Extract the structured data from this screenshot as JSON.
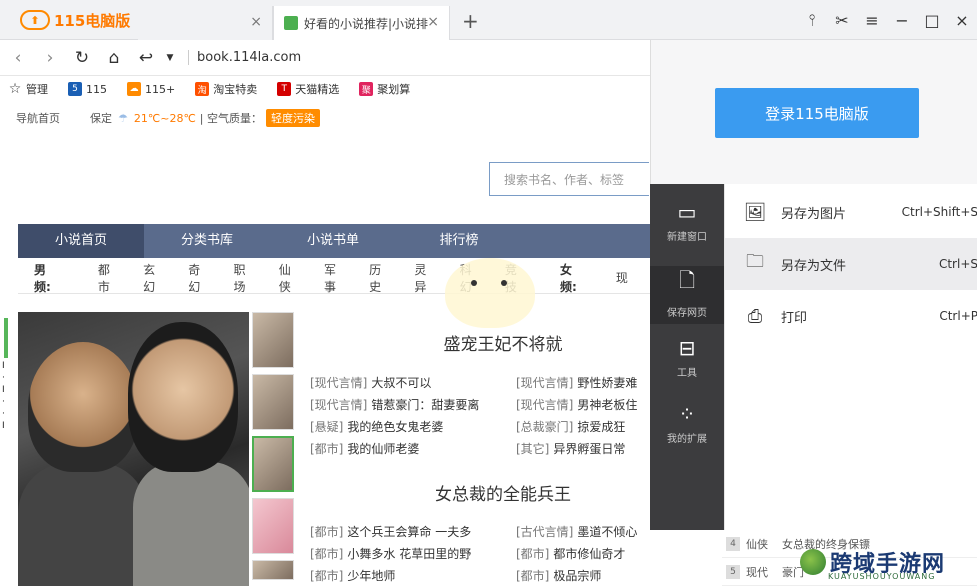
{
  "browser": {
    "logo_text": "115电脑版",
    "tabs": [
      {
        "title": ""
      },
      {
        "title": "好看的小说推荐|小说排"
      }
    ],
    "new_tab": "+",
    "window_controls": [
      "⫯",
      "✂",
      "≡",
      "−",
      "□",
      "×"
    ],
    "url": "book.114la.com"
  },
  "bookmarks": [
    {
      "label": "管理",
      "icon": "star-icon",
      "color": "#333333"
    },
    {
      "label": "115",
      "icon": "115-icon",
      "color": "#1a5fb4"
    },
    {
      "label": "115+",
      "icon": "cloud-icon",
      "color": "#ff8a00"
    },
    {
      "label": "淘宝特卖",
      "icon": "taobao-icon",
      "color": "#ff5000"
    },
    {
      "label": "天猫精选",
      "icon": "tmall-icon",
      "color": "#d40000"
    },
    {
      "label": "聚划算",
      "icon": "juhuasuan-icon",
      "color": "#e0245e"
    }
  ],
  "infobar": {
    "home": "导航首页",
    "city": "保定",
    "temp": "21℃~28℃",
    "air_label": "| 空气质量：",
    "air_badge": "轻度污染"
  },
  "search": {
    "placeholder": "搜索书名、作者、标签"
  },
  "mainnav": [
    "小说首页",
    "分类书库",
    "小说书单",
    "排行榜"
  ],
  "categories": {
    "male_label": "男频:",
    "male": [
      "都市",
      "玄幻",
      "奇幻",
      "职场",
      "仙侠",
      "军事",
      "历史",
      "灵异",
      "科幻",
      "竞技"
    ],
    "female_label": "女频:",
    "female_first": "现"
  },
  "left_glyph": "Ⅰ · Ⅰ · · Ⅰ",
  "books": [
    {
      "title": "盛宠王妃不将就",
      "left": [
        {
          "genre": "[现代言情]",
          "name": "大叔不可以"
        },
        {
          "genre": "[现代言情]",
          "name": "错惹豪门：甜妻要离"
        },
        {
          "genre": "[悬疑]",
          "name": "我的绝色女鬼老婆"
        },
        {
          "genre": "[都市]",
          "name": "我的仙师老婆"
        }
      ],
      "right": [
        {
          "genre": "[现代言情]",
          "name": "野性娇妻难"
        },
        {
          "genre": "[现代言情]",
          "name": "男神老板住"
        },
        {
          "genre": "[总裁豪门]",
          "name": "掠爱成狂"
        },
        {
          "genre": "[其它]",
          "name": "异界孵蛋日常"
        }
      ]
    },
    {
      "title": "女总裁的全能兵王",
      "left": [
        {
          "genre": "[都市]",
          "name": "这个兵王会算命 一夫多"
        },
        {
          "genre": "[都市]",
          "name": "小舞多水 花草田里的野"
        },
        {
          "genre": "[都市]",
          "name": "少年地师"
        }
      ],
      "right": [
        {
          "genre": "[古代言情]",
          "name": "墨道不倾心"
        },
        {
          "genre": "[都市]",
          "name": "都市修仙奇才"
        },
        {
          "genre": "[都市]",
          "name": "极品宗师"
        }
      ]
    }
  ],
  "panel": {
    "login": "登录115电脑版"
  },
  "side_menu": [
    {
      "label": "新建窗口",
      "icon": "window-icon"
    },
    {
      "label": "保存网页",
      "icon": "file-icon"
    },
    {
      "label": "工具",
      "icon": "toolbox-icon"
    },
    {
      "label": "我的扩展",
      "icon": "extensions-icon"
    }
  ],
  "submenu": [
    {
      "label": "另存为图片",
      "shortcut": "Ctrl+Shift+S",
      "icon": "image-icon"
    },
    {
      "label": "另存为文件",
      "shortcut": "Ctrl+S",
      "icon": "folder-icon"
    },
    {
      "label": "打印",
      "shortcut": "Ctrl+P",
      "icon": "printer-icon"
    }
  ],
  "rank_list": [
    {
      "num": "4",
      "genre": "仙侠",
      "name": "女总裁的终身保镖"
    },
    {
      "num": "5",
      "genre": "现代",
      "name": "豪门"
    }
  ],
  "watermark": {
    "cn": "跨域手游网",
    "en": "KUAYUSHOUYOUWANG"
  }
}
